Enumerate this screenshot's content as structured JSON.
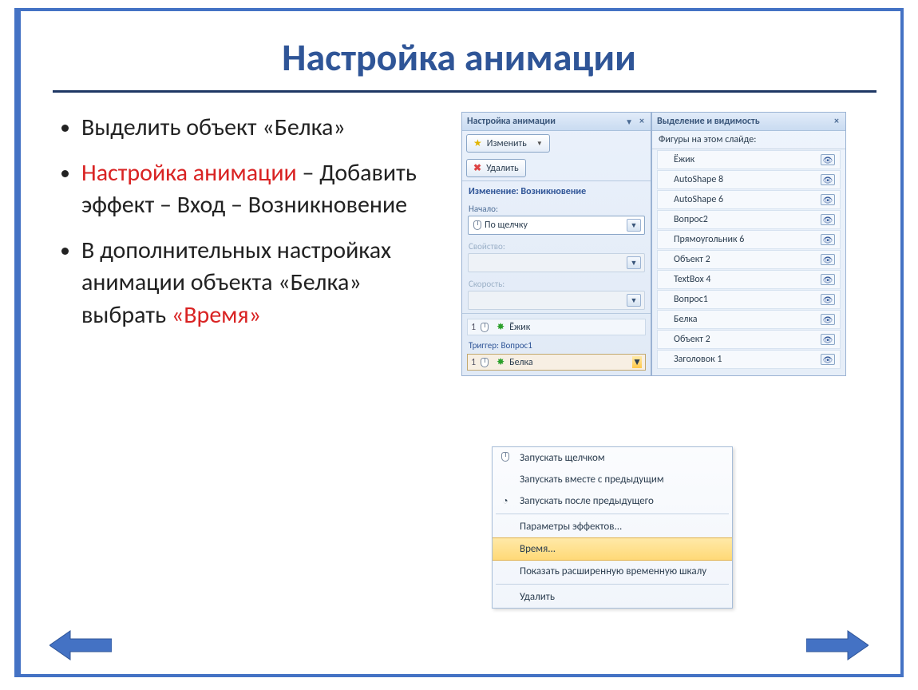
{
  "title": "Настройка анимации",
  "bullet1": "Выделить объект «Белка»",
  "bullet2a": "Настройка анимации",
  "bullet2b": " – Добавить эффект – Вход – Возникновение",
  "bullet3a": "В дополнительных настройках анимации объекта «Белка» выбрать ",
  "bullet3b": "«Время»",
  "anim": {
    "title": "Настройка анимации",
    "change": "Изменить",
    "delete": "Удалить",
    "effect_section": "Изменение: Возникновение",
    "start_label": "Начало:",
    "start_value": "По щелчку",
    "property_label": "Свойство:",
    "speed_label": "Скорость:",
    "list": {
      "row1_num": "1",
      "row1_name": "Ёжик",
      "trigger": "Триггер: Вопрос1",
      "row2_num": "1",
      "row2_name": "Белка"
    }
  },
  "ctx": {
    "m1": "Запускать щелчком",
    "m2": "Запускать вместе с предыдущим",
    "m3": "Запускать после предыдущего",
    "m4": "Параметры эффектов...",
    "m5": "Время...",
    "m6": "Показать расширенную временную шкалу",
    "m7": "Удалить"
  },
  "vis": {
    "title": "Выделение и видимость",
    "subtitle": "Фигуры на этом слайде:",
    "items": [
      "Ёжик",
      "AutoShape 8",
      "AutoShape 6",
      "Вопрос2",
      "Прямоугольник 6",
      "Объект 2",
      "TextBox 4",
      "Вопрос1",
      "Белка",
      "Объект 2",
      "Заголовок 1"
    ]
  }
}
